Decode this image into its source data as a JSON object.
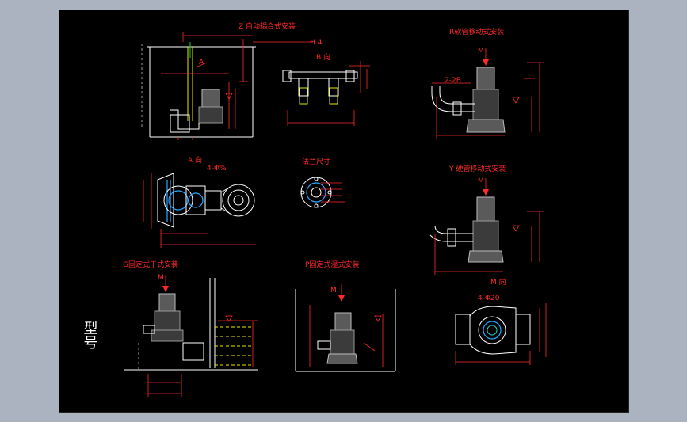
{
  "views": {
    "z": {
      "title": "Z 自动耦合式安装",
      "label_b": "B 向",
      "label_a": "A",
      "label_h": "H 4"
    },
    "r": {
      "title": "R软管移动式安装",
      "label_m": "M",
      "label_dn": "2-2B"
    },
    "a": {
      "title": "A 向",
      "label_holes": "4-Φ%"
    },
    "flange": {
      "title": "法兰尺寸"
    },
    "y": {
      "title": "Y 硬管移动式安装",
      "label_m": "M"
    },
    "g": {
      "title": "G固定式干式安装",
      "label_m": "M"
    },
    "p": {
      "title": "P固定式湿式安装",
      "label_m": "M"
    },
    "m": {
      "title": "M 向",
      "label_holes": "4-Φ20"
    }
  },
  "title_block": {
    "label": "型号"
  },
  "colors": {
    "sheet": "#000000",
    "frame": "#aab3bf",
    "dimension": "#ff2a2a",
    "outline": "#ffffff",
    "pipe": "#2aa7ff"
  }
}
